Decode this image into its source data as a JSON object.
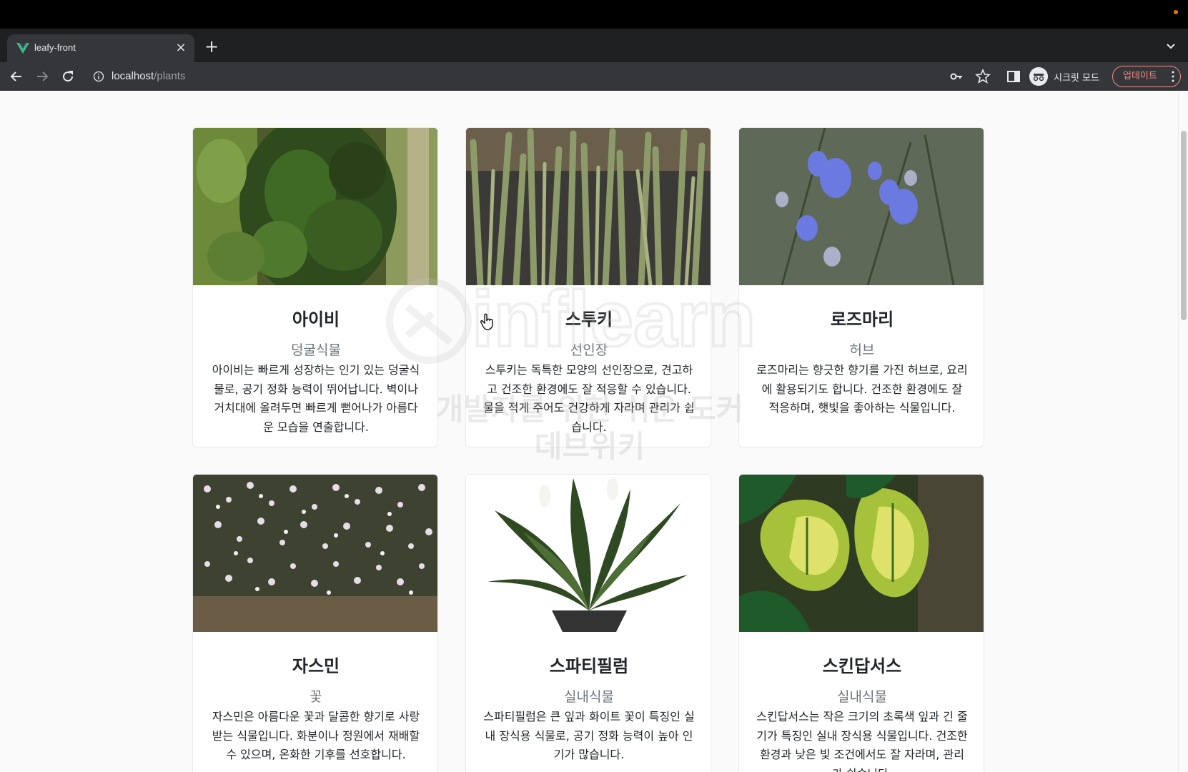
{
  "browser": {
    "tab_title": "leafy-front",
    "url_host": "localhost",
    "url_path": "/plants",
    "incognito_label": "시크릿 모드",
    "update_label": "업데이트"
  },
  "plants": [
    {
      "name": "아이비",
      "type": "덩굴식물",
      "description": "아이비는 빠르게 성장하는 인기 있는 덩굴식물로, 공기 정화 능력이 뛰어납니다. 벽이나 거치대에 올려두면 빠르게 뻗어나가 아름다운 모습을 연출합니다."
    },
    {
      "name": "스투키",
      "type": "선인장",
      "description": "스투키는 독특한 모양의 선인장으로, 견고하고 건조한 환경에도 잘 적응할 수 있습니다. 물을 적게 주어도 건강하게 자라며 관리가 쉽습니다."
    },
    {
      "name": "로즈마리",
      "type": "허브",
      "description": "로즈마리는 향긋한 향기를 가진 허브로, 요리에 활용되기도 합니다. 건조한 환경에도 잘 적응하며, 햇빛을 좋아하는 식물입니다."
    },
    {
      "name": "자스민",
      "type": "꽃",
      "description": "자스민은 아름다운 꽃과 달콤한 향기로 사랑받는 식물입니다. 화분이나 정원에서 재배할 수 있으며, 온화한 기후를 선호합니다."
    },
    {
      "name": "스파티필럼",
      "type": "실내식물",
      "description": "스파티필럼은 큰 잎과 화이트 꽃이 특징인 실내 장식용 식물로, 공기 정화 능력이 높아 인기가 많습니다."
    },
    {
      "name": "스킨답서스",
      "type": "실내식물",
      "description": "스킨답서스는 작은 크기의 초록색 잎과 긴 줄기가 특징인 실내 장식용 식물입니다. 건조한 환경과 낮은 빛 조건에서도 잘 자라며, 관리가 쉽습니다."
    }
  ],
  "watermark": {
    "logo": "inflearn",
    "line1": "개발자를 위한 쉬운 도커",
    "line2": "데브위키"
  },
  "colors": {
    "accent_vue": "#41b883",
    "update_red": "#f28b82"
  }
}
